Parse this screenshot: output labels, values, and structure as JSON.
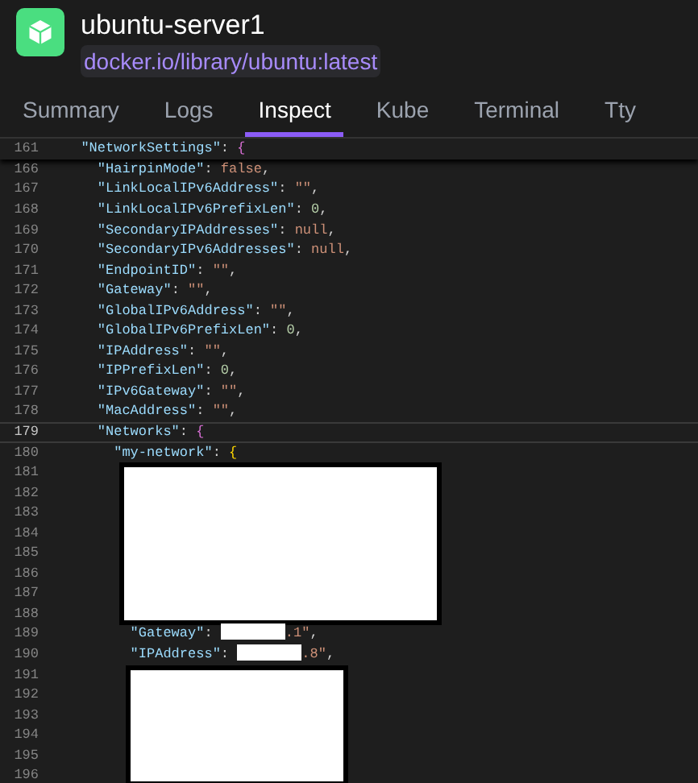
{
  "container": {
    "name": "ubuntu-server1",
    "image": "docker.io/library/ubuntu:latest"
  },
  "tabs": [
    {
      "label": "Summary",
      "selected": false
    },
    {
      "label": "Logs",
      "selected": false
    },
    {
      "label": "Inspect",
      "selected": true
    },
    {
      "label": "Kube",
      "selected": false
    },
    {
      "label": "Terminal",
      "selected": false
    },
    {
      "label": "Tty",
      "selected": false
    }
  ],
  "editor": {
    "sticky_line": {
      "number": "161",
      "tokens": [
        {
          "kind": "key",
          "text": "  \"NetworkSettings\""
        },
        {
          "kind": "punct",
          "text": ": "
        },
        {
          "kind": "brace",
          "text": "{"
        }
      ]
    },
    "lines": [
      {
        "kind": "code",
        "number": "166",
        "current": false,
        "tokens": [
          {
            "kind": "key",
            "text": "    \"HairpinMode\""
          },
          {
            "kind": "punct",
            "text": ": "
          },
          {
            "kind": "keyword",
            "text": "false"
          },
          {
            "kind": "punct",
            "text": ","
          }
        ]
      },
      {
        "kind": "code",
        "number": "167",
        "current": false,
        "tokens": [
          {
            "kind": "key",
            "text": "    \"LinkLocalIPv6Address\""
          },
          {
            "kind": "punct",
            "text": ": "
          },
          {
            "kind": "string",
            "text": "\"\""
          },
          {
            "kind": "punct",
            "text": ","
          }
        ]
      },
      {
        "kind": "code",
        "number": "168",
        "current": false,
        "tokens": [
          {
            "kind": "key",
            "text": "    \"LinkLocalIPv6PrefixLen\""
          },
          {
            "kind": "punct",
            "text": ": "
          },
          {
            "kind": "number",
            "text": "0"
          },
          {
            "kind": "punct",
            "text": ","
          }
        ]
      },
      {
        "kind": "code",
        "number": "169",
        "current": false,
        "tokens": [
          {
            "kind": "key",
            "text": "    \"SecondaryIPAddresses\""
          },
          {
            "kind": "punct",
            "text": ": "
          },
          {
            "kind": "keyword",
            "text": "null"
          },
          {
            "kind": "punct",
            "text": ","
          }
        ]
      },
      {
        "kind": "code",
        "number": "170",
        "current": false,
        "tokens": [
          {
            "kind": "key",
            "text": "    \"SecondaryIPv6Addresses\""
          },
          {
            "kind": "punct",
            "text": ": "
          },
          {
            "kind": "keyword",
            "text": "null"
          },
          {
            "kind": "punct",
            "text": ","
          }
        ]
      },
      {
        "kind": "code",
        "number": "171",
        "current": false,
        "tokens": [
          {
            "kind": "key",
            "text": "    \"EndpointID\""
          },
          {
            "kind": "punct",
            "text": ": "
          },
          {
            "kind": "string",
            "text": "\"\""
          },
          {
            "kind": "punct",
            "text": ","
          }
        ]
      },
      {
        "kind": "code",
        "number": "172",
        "current": false,
        "tokens": [
          {
            "kind": "key",
            "text": "    \"Gateway\""
          },
          {
            "kind": "punct",
            "text": ": "
          },
          {
            "kind": "string",
            "text": "\"\""
          },
          {
            "kind": "punct",
            "text": ","
          }
        ]
      },
      {
        "kind": "code",
        "number": "173",
        "current": false,
        "tokens": [
          {
            "kind": "key",
            "text": "    \"GlobalIPv6Address\""
          },
          {
            "kind": "punct",
            "text": ": "
          },
          {
            "kind": "string",
            "text": "\"\""
          },
          {
            "kind": "punct",
            "text": ","
          }
        ]
      },
      {
        "kind": "code",
        "number": "174",
        "current": false,
        "tokens": [
          {
            "kind": "key",
            "text": "    \"GlobalIPv6PrefixLen\""
          },
          {
            "kind": "punct",
            "text": ": "
          },
          {
            "kind": "number",
            "text": "0"
          },
          {
            "kind": "punct",
            "text": ","
          }
        ]
      },
      {
        "kind": "code",
        "number": "175",
        "current": false,
        "tokens": [
          {
            "kind": "key",
            "text": "    \"IPAddress\""
          },
          {
            "kind": "punct",
            "text": ": "
          },
          {
            "kind": "string",
            "text": "\"\""
          },
          {
            "kind": "punct",
            "text": ","
          }
        ]
      },
      {
        "kind": "code",
        "number": "176",
        "current": false,
        "tokens": [
          {
            "kind": "key",
            "text": "    \"IPPrefixLen\""
          },
          {
            "kind": "punct",
            "text": ": "
          },
          {
            "kind": "number",
            "text": "0"
          },
          {
            "kind": "punct",
            "text": ","
          }
        ]
      },
      {
        "kind": "code",
        "number": "177",
        "current": false,
        "tokens": [
          {
            "kind": "key",
            "text": "    \"IPv6Gateway\""
          },
          {
            "kind": "punct",
            "text": ": "
          },
          {
            "kind": "string",
            "text": "\"\""
          },
          {
            "kind": "punct",
            "text": ","
          }
        ]
      },
      {
        "kind": "code",
        "number": "178",
        "current": false,
        "tokens": [
          {
            "kind": "key",
            "text": "    \"MacAddress\""
          },
          {
            "kind": "punct",
            "text": ": "
          },
          {
            "kind": "string",
            "text": "\"\""
          },
          {
            "kind": "punct",
            "text": ","
          }
        ]
      },
      {
        "kind": "code",
        "number": "179",
        "current": true,
        "tokens": [
          {
            "kind": "key",
            "text": "    \"Networks\""
          },
          {
            "kind": "punct",
            "text": ": "
          },
          {
            "kind": "brace",
            "text": "{"
          }
        ]
      },
      {
        "kind": "code",
        "number": "180",
        "current": false,
        "tokens": [
          {
            "kind": "key",
            "text": "      \"my-network\""
          },
          {
            "kind": "punct",
            "text": ": "
          },
          {
            "kind": "brace2",
            "text": "{"
          }
        ]
      },
      {
        "kind": "redacted",
        "wide": true,
        "numbers": [
          "181",
          "182",
          "183",
          "184",
          "185",
          "186",
          "187",
          "188"
        ]
      },
      {
        "kind": "code",
        "number": "189",
        "current": false,
        "tokens": [
          {
            "kind": "key",
            "text": "        \"Gateway\""
          },
          {
            "kind": "punct",
            "text": ": "
          },
          {
            "kind": "redaction"
          },
          {
            "kind": "string",
            "text": ".1\""
          },
          {
            "kind": "punct",
            "text": ","
          }
        ]
      },
      {
        "kind": "code",
        "number": "190",
        "current": false,
        "tokens": [
          {
            "kind": "key",
            "text": "        \"IPAddress\""
          },
          {
            "kind": "punct",
            "text": ": "
          },
          {
            "kind": "redaction"
          },
          {
            "kind": "string",
            "text": ".8\""
          },
          {
            "kind": "punct",
            "text": ","
          }
        ]
      },
      {
        "kind": "redacted",
        "wide": false,
        "numbers": [
          "191",
          "192",
          "193",
          "194",
          "195",
          "196"
        ]
      }
    ]
  }
}
